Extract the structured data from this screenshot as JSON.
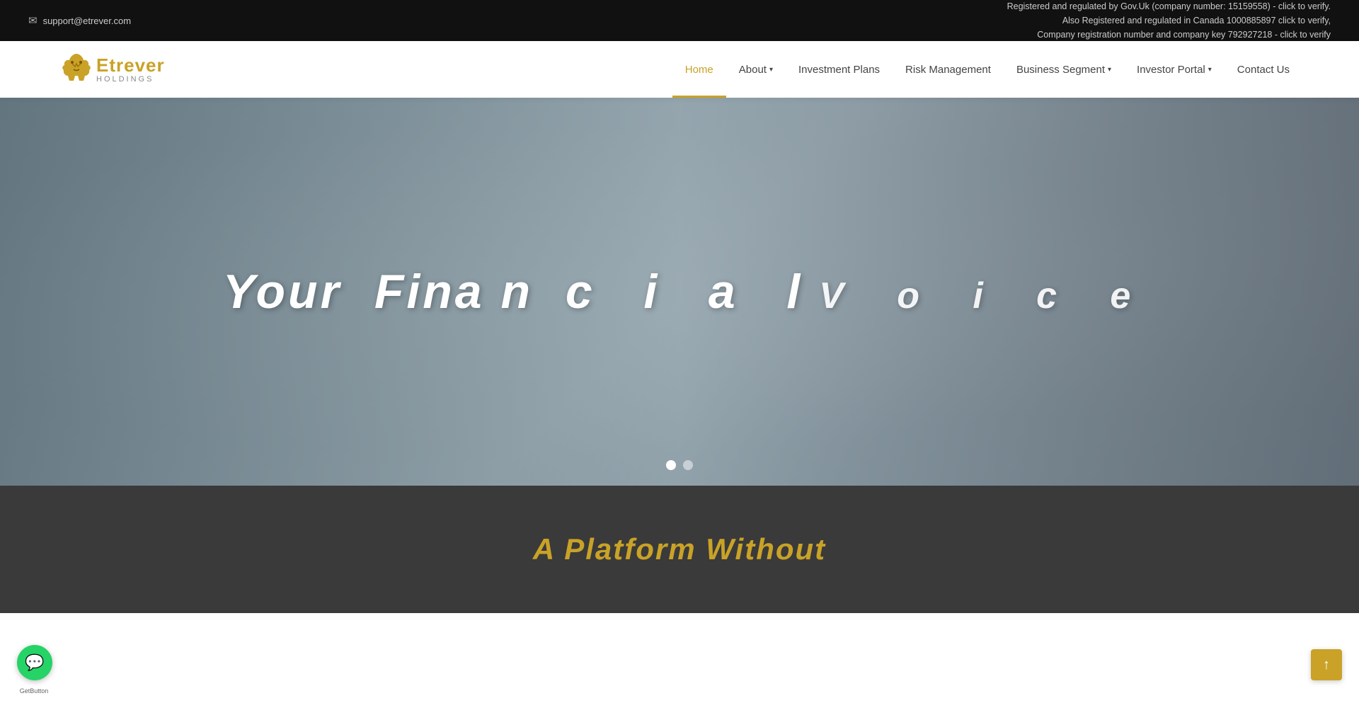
{
  "topbar": {
    "email": "support@etrever.com",
    "reg_text_1": "Registered and regulated by Gov.Uk (company number: 15159558) - click to verify.",
    "reg_text_2": "Also Registered and regulated in Canada 1000885897 click to verify,",
    "reg_text_3": "Company registration number and company key 792927218 - click to verify"
  },
  "logo": {
    "name": "Etrever",
    "sub": "Holdings"
  },
  "nav": {
    "items": [
      {
        "label": "Home",
        "active": true,
        "has_dropdown": false
      },
      {
        "label": "About",
        "active": false,
        "has_dropdown": true
      },
      {
        "label": "Investment Plans",
        "active": false,
        "has_dropdown": false
      },
      {
        "label": "Risk Management",
        "active": false,
        "has_dropdown": false
      },
      {
        "label": "Business Segment",
        "active": false,
        "has_dropdown": true
      },
      {
        "label": "Investor Portal",
        "active": false,
        "has_dropdown": true
      },
      {
        "label": "Contact Us",
        "active": false,
        "has_dropdown": false
      }
    ]
  },
  "hero": {
    "line1": "Your Finan  c  i  a  l",
    "line2": "V  o  i  c  e",
    "animated_partial": "Your Fina n  c  i  a  l"
  },
  "slider": {
    "dots": [
      {
        "active": true
      },
      {
        "active": false
      }
    ]
  },
  "below_hero": {
    "title": "A Platform Without"
  },
  "whatsapp": {
    "label": "GetButton"
  }
}
